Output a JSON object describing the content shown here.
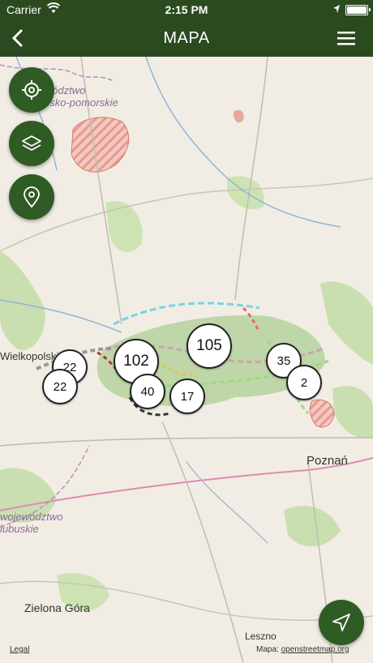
{
  "status": {
    "carrier": "Carrier",
    "time": "2:15 PM"
  },
  "nav": {
    "title": "MAPA",
    "back_icon": "chevron-left-icon",
    "menu_icon": "hamburger-menu-icon"
  },
  "map_labels": {
    "region_top_line1": "województwo",
    "region_top_line2": "kujawsko-pomorskie",
    "wielkopolskie": "Wielkopolskie",
    "region_left_line1": "województwo",
    "region_left_line2": "lubuskie",
    "poznan": "Poznań",
    "zielona_gora": "Zielona Góra",
    "leszno": "Leszno"
  },
  "clusters": [
    {
      "label": "22"
    },
    {
      "label": "22"
    },
    {
      "label": "102"
    },
    {
      "label": "40"
    },
    {
      "label": "17"
    },
    {
      "label": "105"
    },
    {
      "label": "35"
    },
    {
      "label": "2"
    }
  ],
  "controls": {
    "locate_icon": "crosshair-icon",
    "layers_icon": "layers-icon",
    "poi_icon": "map-pin-icon",
    "navigate_icon": "navigation-arrow-icon"
  },
  "attribution": {
    "legal": "Legal",
    "source_prefix": "Mapa: ",
    "source": "openstreetmap.org"
  },
  "colors": {
    "header": "#2c4a20",
    "fab": "#2f5b24"
  }
}
